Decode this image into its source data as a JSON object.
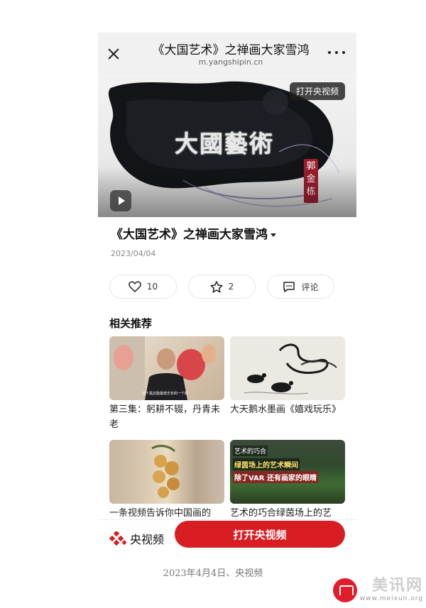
{
  "header": {
    "title": "《大国艺术》之禅画大家雪鸿",
    "domain": "m.yangshipin.cn"
  },
  "video": {
    "logo_text": "大國藝術",
    "seal_text": "郭金栋",
    "open_app_chip": "打开央视频"
  },
  "article": {
    "title": "《大国艺术》之禅画大家雪鸿",
    "date": "2023/04/04"
  },
  "actions": {
    "like_count": "10",
    "favorite_count": "2",
    "comment_label": "评论"
  },
  "recommend": {
    "section_title": "相关推荐",
    "items": [
      {
        "title": "第三集：躬耕不辍，丹青未老",
        "thumb_caption": "这个黑还能最低乐年的一个的"
      },
      {
        "title": "大天鹅水墨画《嬉戏玩乐》"
      },
      {
        "title": "一条视频告诉你中国画的"
      },
      {
        "title": "艺术的巧合绿茵场上的艺",
        "thumb_text1": "艺术的巧合",
        "thumb_text2": "绿茵场上的艺术瞬间",
        "thumb_text3": "除了VAR 还有画家的眼睛"
      }
    ]
  },
  "bottom_bar": {
    "brand_name": "央视频",
    "open_app_button": "打开央视频"
  },
  "footer": {
    "caption": "2023年4月4日、央视频"
  },
  "watermark": {
    "name": "美讯网",
    "url": "www.meixun.org"
  },
  "colors": {
    "accent_red": "#d81e22",
    "chip_bg": "#1e1e1e",
    "seal_red": "#9a1e2e"
  }
}
